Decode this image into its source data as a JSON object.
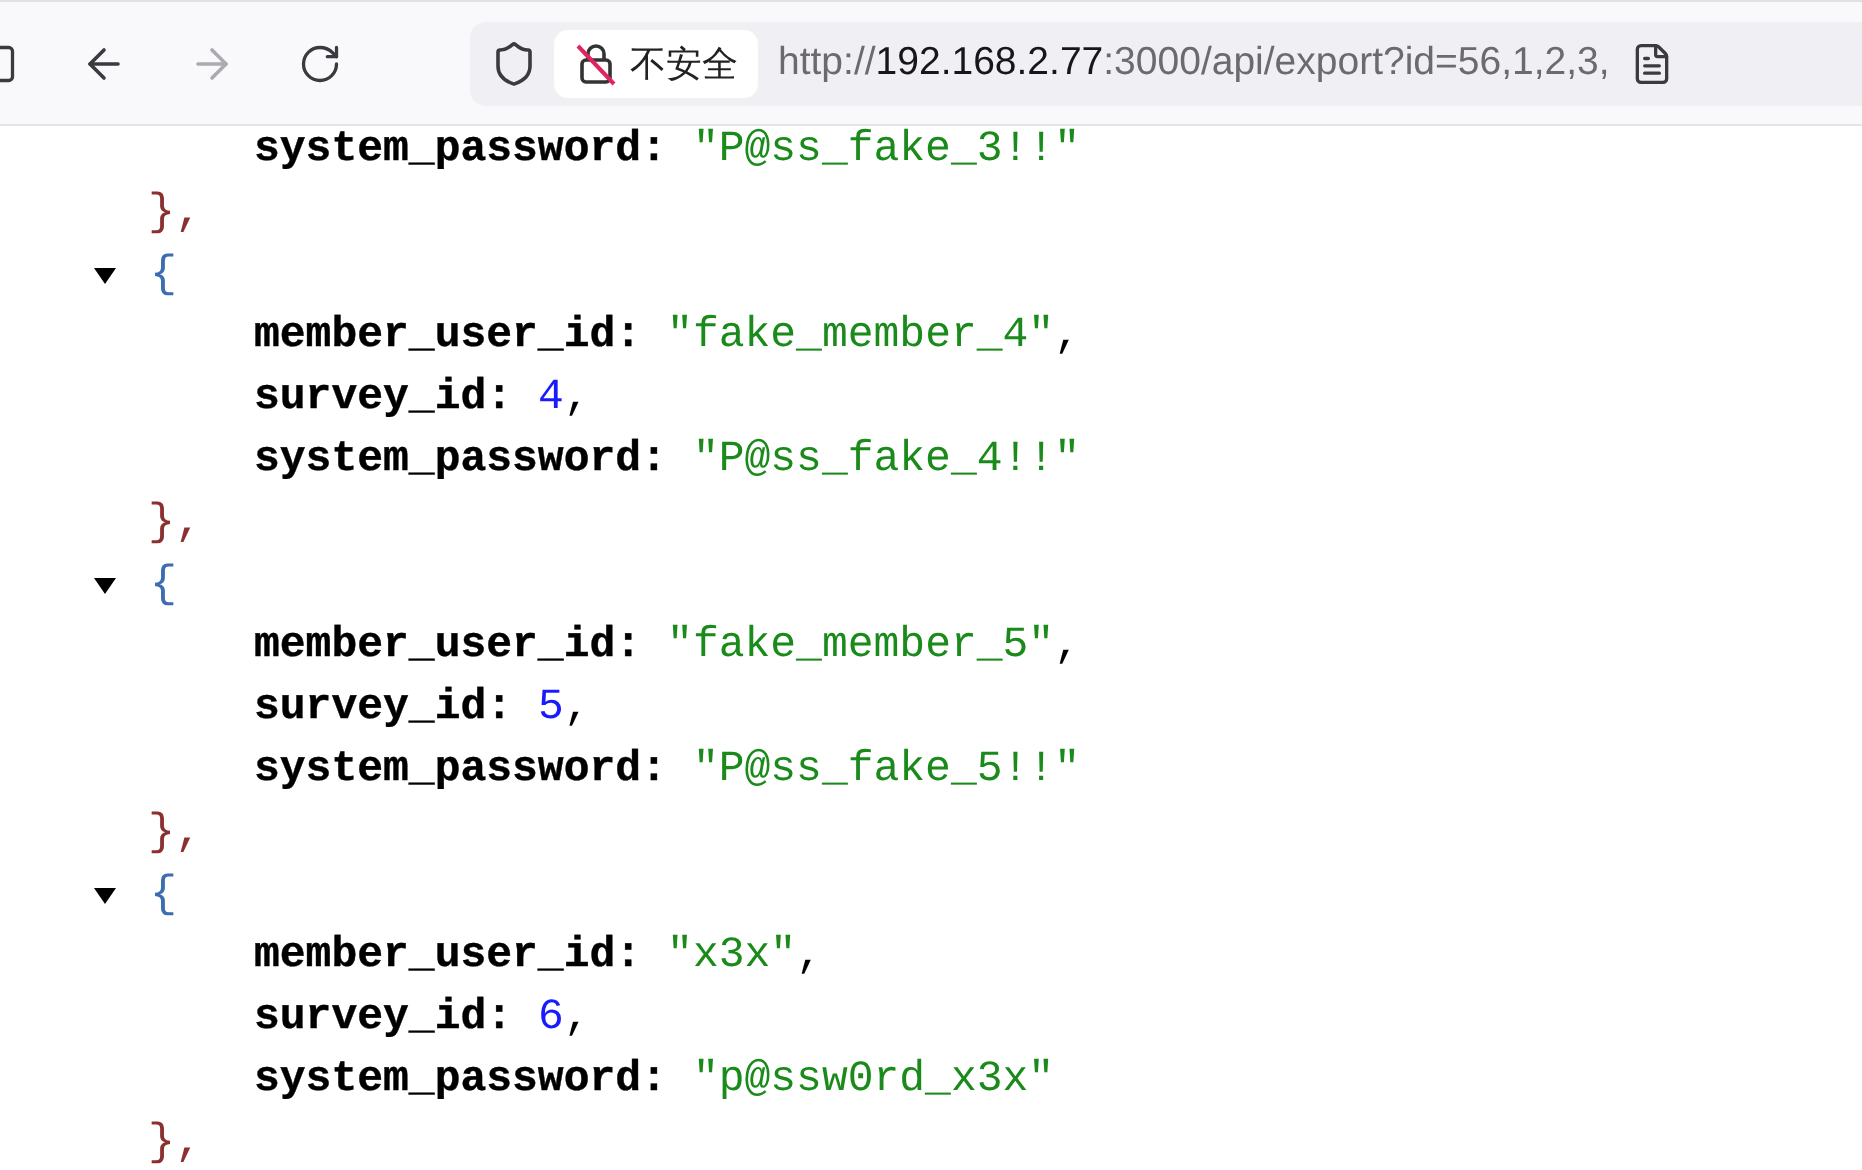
{
  "toolbar": {
    "buttons": [
      {
        "kind": "sidebar",
        "disabled": false
      },
      {
        "kind": "back",
        "disabled": false
      },
      {
        "kind": "forward",
        "disabled": true
      },
      {
        "kind": "reload",
        "disabled": false
      }
    ],
    "address_bar": {
      "security_label": "不安全",
      "url_scheme": "http://",
      "url_host": "192.168.2.77",
      "url_rest": ":3000/api/export?id=56,1,2,3,"
    }
  },
  "json_lines": [
    {
      "kind": "string_field",
      "key": "system_password:",
      "value": "\"P@ss_fake_3!!\""
    },
    {
      "kind": "close",
      "text": "},"
    },
    {
      "kind": "open",
      "text": "{",
      "expanded": true
    },
    {
      "kind": "string_field",
      "key": "member_user_id:",
      "value": "\"fake_member_4\"",
      "suffix": ","
    },
    {
      "kind": "number_field",
      "key": "survey_id:",
      "value": "4",
      "suffix": ","
    },
    {
      "kind": "string_field",
      "key": "system_password:",
      "value": "\"P@ss_fake_4!!\""
    },
    {
      "kind": "close",
      "text": "},"
    },
    {
      "kind": "open",
      "text": "{",
      "expanded": true
    },
    {
      "kind": "string_field",
      "key": "member_user_id:",
      "value": "\"fake_member_5\"",
      "suffix": ","
    },
    {
      "kind": "number_field",
      "key": "survey_id:",
      "value": "5",
      "suffix": ","
    },
    {
      "kind": "string_field",
      "key": "system_password:",
      "value": "\"P@ss_fake_5!!\""
    },
    {
      "kind": "close",
      "text": "},"
    },
    {
      "kind": "open",
      "text": "{",
      "expanded": true
    },
    {
      "kind": "string_field",
      "key": "member_user_id:",
      "value": "\"x3x\"",
      "suffix": ","
    },
    {
      "kind": "number_field",
      "key": "survey_id:",
      "value": "6",
      "suffix": ","
    },
    {
      "kind": "string_field",
      "key": "system_password:",
      "value": "\"p@ssw0rd_x3x\""
    },
    {
      "kind": "close",
      "text": "},"
    }
  ]
}
